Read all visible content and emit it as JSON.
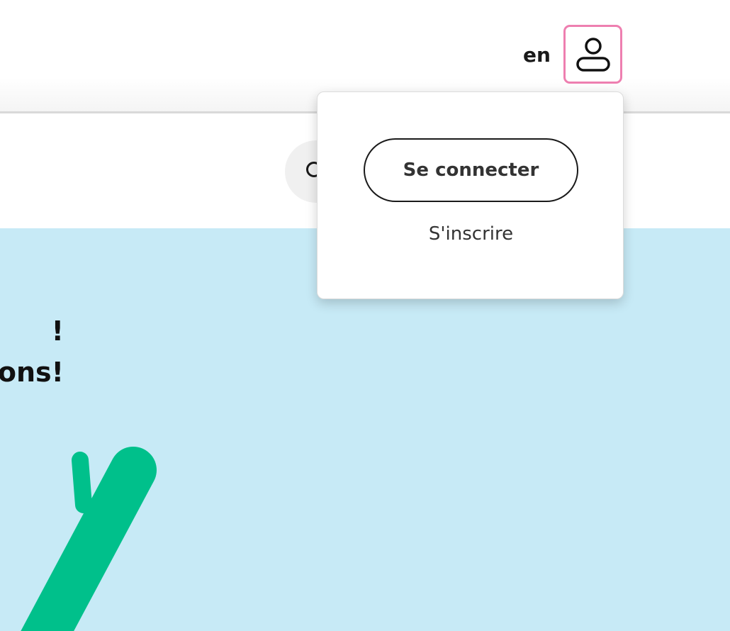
{
  "header": {
    "language_label": "en",
    "account_icon": "user-icon",
    "account_button_border_color": "#ee7fb0"
  },
  "nav": {
    "search_icon": "search-icon"
  },
  "account_menu": {
    "login_label": "Se connecter",
    "signup_label": "S'inscrire"
  },
  "hero": {
    "line_1": "!",
    "line_2": "ons!",
    "background_color": "#c7eaf6",
    "illustration_color": "#00c08b"
  }
}
